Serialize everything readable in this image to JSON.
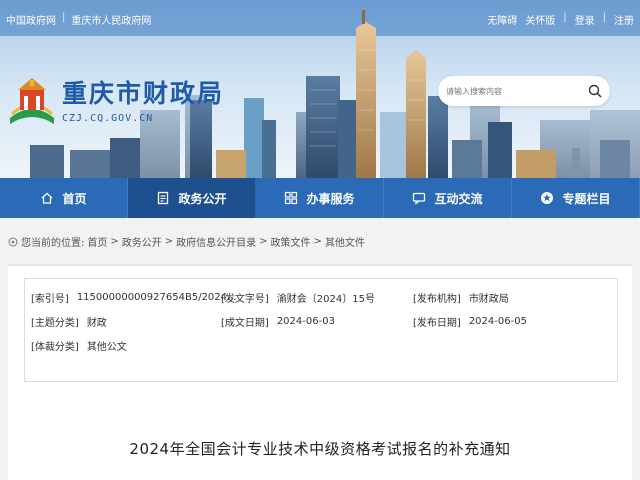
{
  "top_links": {
    "left": [
      "中国政府网",
      "重庆市人民政府网"
    ],
    "right": [
      "无障碍",
      "关怀版",
      "登录",
      "注册"
    ]
  },
  "logo": {
    "title": "重庆市财政局",
    "subtitle": "CZJ.CQ.GOV.CN"
  },
  "search": {
    "placeholder": "请输入搜索内容"
  },
  "nav": [
    {
      "label": "首页",
      "icon": "home-icon"
    },
    {
      "label": "政务公开",
      "icon": "document-icon"
    },
    {
      "label": "办事服务",
      "icon": "grid-icon"
    },
    {
      "label": "互动交流",
      "icon": "chat-icon"
    },
    {
      "label": "专题栏目",
      "icon": "star-icon"
    }
  ],
  "nav_active_index": 1,
  "breadcrumb": {
    "prefix": "您当前的位置:",
    "items": [
      "首页",
      "政务公开",
      "政府信息公开目录",
      "政策文件",
      "其他文件"
    ],
    "separator": ">"
  },
  "meta": {
    "index_no": {
      "key": "[索引号]",
      "value": "11500000000927654B5/2024..."
    },
    "doc_no": {
      "key": "[发文字号]",
      "value": "渝财会〔2024〕15号"
    },
    "publisher": {
      "key": "[发布机构]",
      "value": "市财政局"
    },
    "topic": {
      "key": "[主题分类]",
      "value": "财政"
    },
    "created": {
      "key": "[成文日期]",
      "value": "2024-06-03"
    },
    "published": {
      "key": "[发布日期]",
      "value": "2024-06-05"
    },
    "genre": {
      "key": "[体裁分类]",
      "value": "其他公文"
    }
  },
  "article_title": "2024年全国会计专业技术中级资格考试报名的补充通知",
  "colors": {
    "nav_bg": "#2a6ab6",
    "nav_active": "#1e4f8e",
    "brand_blue": "#1f5ba8"
  }
}
